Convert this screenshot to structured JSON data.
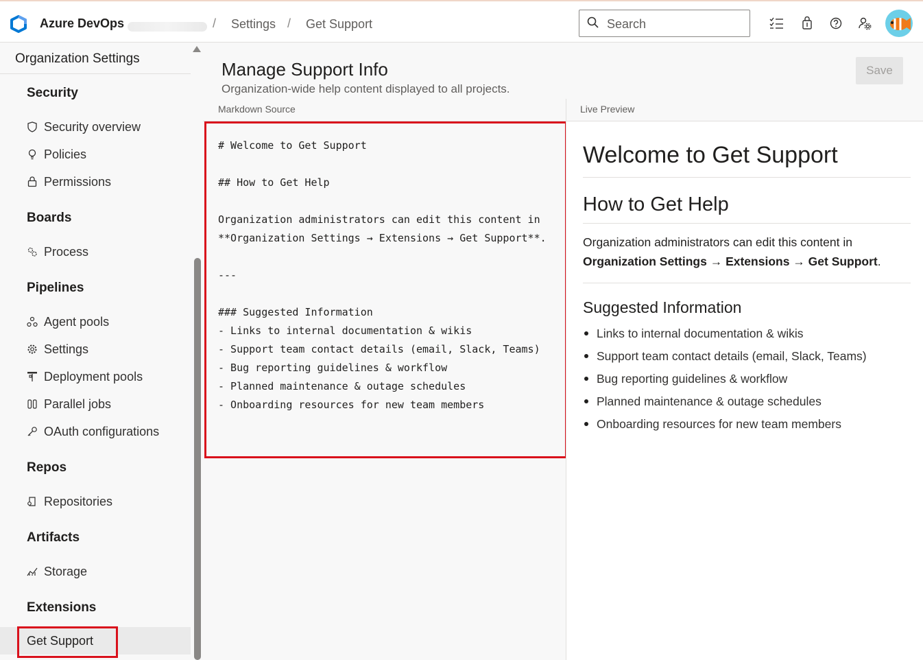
{
  "header": {
    "brand": "Azure DevOps",
    "breadcrumbs": [
      "Settings",
      "Get Support"
    ],
    "separator": "/",
    "search_placeholder": "Search",
    "icons": [
      "task-list-icon",
      "shopping-bag-icon",
      "help-icon",
      "user-settings-icon"
    ]
  },
  "sidebar": {
    "title": "Organization Settings",
    "sections": {
      "security": "Security",
      "boards": "Boards",
      "pipelines": "Pipelines",
      "repos": "Repos",
      "artifacts": "Artifacts",
      "extensions": "Extensions"
    },
    "items": {
      "security_overview": "Security overview",
      "policies": "Policies",
      "permissions": "Permissions",
      "process": "Process",
      "agent_pools": "Agent pools",
      "settings": "Settings",
      "deployment_pools": "Deployment pools",
      "parallel_jobs": "Parallel jobs",
      "oauth": "OAuth configurations",
      "repositories": "Repositories",
      "storage": "Storage",
      "get_support": "Get Support"
    },
    "selected": "Get Support"
  },
  "main": {
    "title": "Manage Support Info",
    "subtitle": "Organization-wide help content displayed to all projects.",
    "save_label": "Save",
    "markdown_label": "Markdown Source",
    "preview_label": "Live Preview",
    "markdown_source": "# Welcome to Get Support\n\n## How to Get Help\n\nOrganization administrators can edit this content in **Organization Settings → Extensions → Get Support**.\n\n---\n\n### Suggested Information\n- Links to internal documentation & wikis\n- Support team contact details (email, Slack, Teams)\n- Bug reporting guidelines & workflow\n- Planned maintenance & outage schedules\n- Onboarding resources for new team members",
    "preview": {
      "h1": "Welcome to Get Support",
      "h2": "How to Get Help",
      "para_text": "Organization administrators can edit this content in",
      "para_bold": "Organization Settings → Extensions → Get Support",
      "para_end": ".",
      "h3": "Suggested Information",
      "list": [
        "Links to internal documentation & wikis",
        "Support team contact details (email, Slack, Teams)",
        "Bug reporting guidelines & workflow",
        "Planned maintenance & outage schedules",
        "Onboarding resources for new team members"
      ]
    }
  },
  "colors": {
    "highlight": "#d9111c",
    "brand_blue": "#0078d4"
  }
}
